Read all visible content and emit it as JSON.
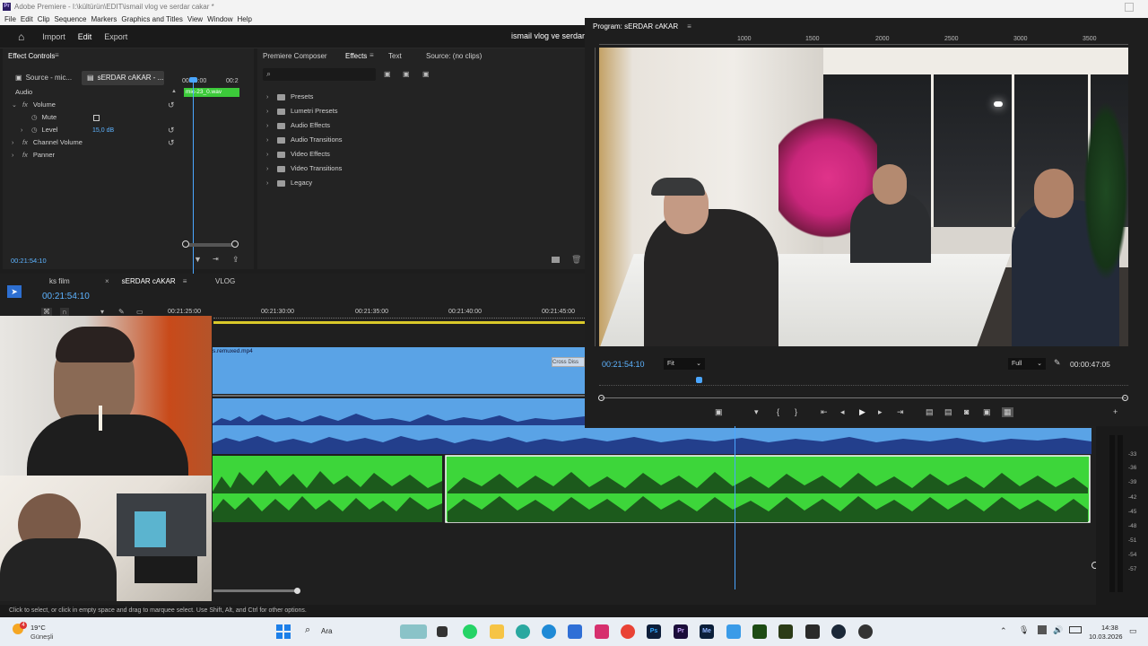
{
  "window": {
    "title": "Adobe Premiere - I:\\kültürün\\EDIT\\ismail vlog ve serdar cakar *",
    "app_icon": "Pr"
  },
  "menu": [
    "File",
    "Edit",
    "Clip",
    "Sequence",
    "Markers",
    "Graphics and Titles",
    "View",
    "Window",
    "Help"
  ],
  "header": {
    "import": "Import",
    "edit": "Edit",
    "export": "Export",
    "project": "ismail vlog ve serdar"
  },
  "effect_controls": {
    "title": "Effect Controls",
    "source_tab": "Source - mic...",
    "seq_tab": "sERDAR cAKAR - ...",
    "ruler_times": [
      "00:00:00",
      "00:2"
    ],
    "clip_label": "mic-23_0.wav",
    "section": "Audio",
    "rows": [
      {
        "label": "Volume",
        "indent": 0
      },
      {
        "label": "Mute",
        "indent": 1
      },
      {
        "label": "Level",
        "indent": 1,
        "value": "15,0 dB"
      },
      {
        "label": "Channel Volume",
        "indent": 0
      },
      {
        "label": "Panner",
        "indent": 0
      }
    ],
    "timecode": "00:21:54:10"
  },
  "effects_panel": {
    "tabs": [
      "Premiere Composer",
      "Effects",
      "Text",
      "Source: (no clips)"
    ],
    "active_tab": "Effects",
    "search_placeholder": "",
    "folders": [
      "Presets",
      "Lumetri Presets",
      "Audio Effects",
      "Audio Transitions",
      "Video Effects",
      "Video Transitions",
      "Legacy"
    ]
  },
  "program": {
    "title": "Program: sERDAR cAKAR",
    "ruler": [
      "1000",
      "1500",
      "2000",
      "2500",
      "3000",
      "3500"
    ],
    "timecode": "00:21:54:10",
    "fit": "Fit",
    "quality": "Full",
    "duration": "00:00:47:05"
  },
  "timeline": {
    "tabs": [
      "ks film",
      "sERDAR cAKAR",
      "VLOG"
    ],
    "active_tab": "sERDAR cAKAR",
    "timecode": "00:21:54:10",
    "ruler": [
      "00:21:25:00",
      "00:21:30:00",
      "00:21:35:00",
      "00:21:40:00",
      "00:21:45:00"
    ],
    "clip_label": "s.remuxed.mp4",
    "transition_label": "Cross Diss",
    "meter_db": [
      "-33",
      "-36",
      "-39",
      "-42",
      "-45",
      "-48",
      "-51",
      "-54",
      "-57"
    ]
  },
  "status": "Click to select, or click in empty space and drag to marquee select. Use Shift, Alt, and Ctrl for other options.",
  "taskbar": {
    "weather_temp": "19°C",
    "weather_desc": "Güneşli",
    "search": "Ara",
    "time": "14:38",
    "date": "10.03.2026",
    "notif_count": "4"
  },
  "colors": {
    "accent": "#2d8ceb",
    "timecode": "#5db3ff",
    "audio_green": "#3dd63a",
    "video_blue": "#5aa3e6"
  }
}
